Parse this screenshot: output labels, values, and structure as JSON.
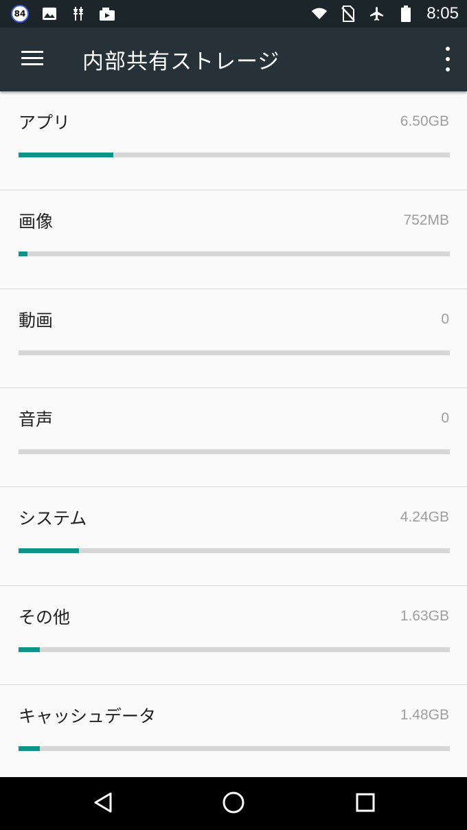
{
  "status_bar": {
    "notification_badge": "84",
    "time": "8:05",
    "icons": [
      "notification-84-icon",
      "image-icon",
      "usb-debug-icon",
      "video-library-icon",
      "wifi-icon",
      "no-sim-icon",
      "airplane-icon",
      "battery-icon"
    ]
  },
  "app_bar": {
    "title": "内部共有ストレージ",
    "menu_icon": "hamburger-menu-icon",
    "overflow_icon": "more-vert-icon"
  },
  "storage_items": [
    {
      "label": "アプリ",
      "value": "6.50GB",
      "usage_fraction": 0.22
    },
    {
      "label": "画像",
      "value": "752MB",
      "usage_fraction": 0.02
    },
    {
      "label": "動画",
      "value": "0",
      "usage_fraction": 0
    },
    {
      "label": "音声",
      "value": "0",
      "usage_fraction": 0
    },
    {
      "label": "システム",
      "value": "4.24GB",
      "usage_fraction": 0.14
    },
    {
      "label": "その他",
      "value": "1.63GB",
      "usage_fraction": 0.05
    },
    {
      "label": "キャッシュデータ",
      "value": "1.48GB",
      "usage_fraction": 0.05
    }
  ],
  "nav_bar": {
    "icons": [
      "back-icon",
      "home-icon",
      "recents-icon"
    ]
  },
  "colors": {
    "status_bar_bg": "#1c2529",
    "app_bar_bg": "#263238",
    "accent": "#0f9488",
    "track": "#d6d6d6",
    "secondary_text": "#9e9e9e"
  }
}
